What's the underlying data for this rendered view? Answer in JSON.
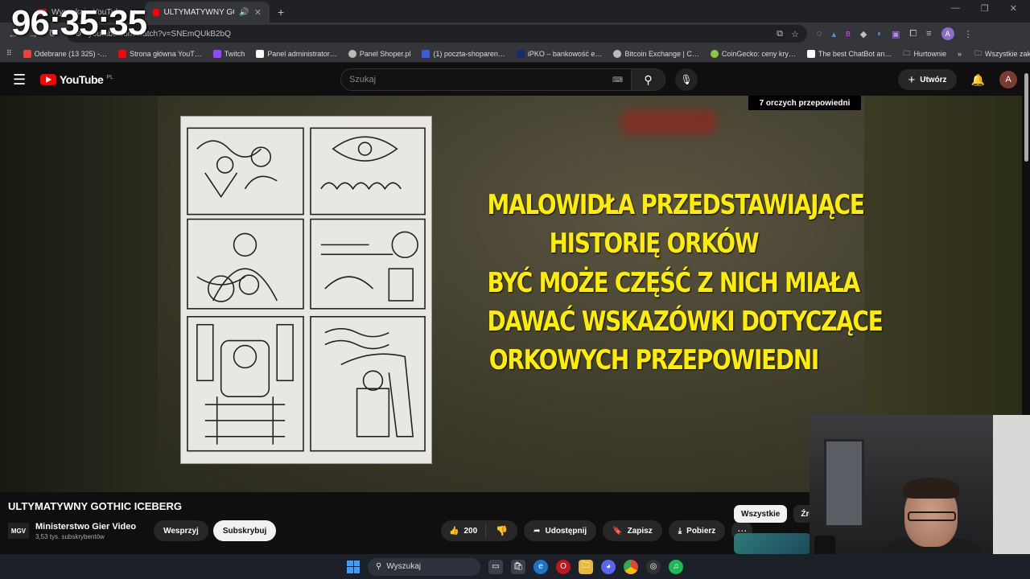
{
  "overlay": {
    "timer": "96:35:35"
  },
  "browser": {
    "tabs": [
      {
        "label": "Wyszukaj - YouTube",
        "active": false
      },
      {
        "label": "ULTYMATYWNY GOTHIC IC…",
        "active": true
      }
    ],
    "new_tab": "+",
    "url": "youtube.com/watch?v=SNEmQUkB2bQ",
    "bookmarks": [
      {
        "label": "Odebrane (13 325) -…",
        "color": "#ea4335"
      },
      {
        "label": "Strona główna YouT…",
        "color": "#ff0000"
      },
      {
        "label": "Twitch",
        "color": "#9146ff"
      },
      {
        "label": "Panel administrator…",
        "color": "#ffffff"
      },
      {
        "label": "Panel Shoper.pl",
        "color": "#bbbbbb"
      },
      {
        "label": "(1) poczta-shoparen…",
        "color": "#3b5bdb"
      },
      {
        "label": "iPKO – bankowość e…",
        "color": "#1b2a6b"
      },
      {
        "label": "Bitcoin Exchange | C…",
        "color": "#bbbbbb"
      },
      {
        "label": "CoinGecko: ceny kry…",
        "color": "#8dc63f"
      },
      {
        "label": "The best ChatBot an…",
        "color": "#ffffff"
      },
      {
        "label": "Hurtownie",
        "color": "#9aa0a6"
      }
    ],
    "all_bookmarks": "Wszystkie zakładki"
  },
  "youtube": {
    "logo_text": "YouTube",
    "region": "PL",
    "search_placeholder": "Szukaj",
    "create_label": "Utwórz",
    "avatar_letter": "A"
  },
  "video": {
    "corner_label": "7 orczych przepowiedni",
    "caption_lines": [
      "MALOWIDŁA PRZEDSTAWIAJĄCE",
      "HISTORIĘ ORKÓW",
      "BYĆ MOŻE CZĘŚĆ Z NICH MIAŁA",
      "DAWAĆ WSKAZÓWKI DOTYCZĄCE",
      "ORKOWYCH PRZEPOWIEDNI"
    ],
    "title": "ULTYMATYWNY GOTHIC ICEBERG",
    "channel": {
      "name": "Ministerstwo Gier Video",
      "subs": "3,53 tys. subskrybentów",
      "support_label": "Wesprzyj",
      "subscribe_label": "Subskrybuj"
    },
    "actions": {
      "likes": "200",
      "share": "Udostępnij",
      "save": "Zapisz",
      "download": "Pobierz"
    }
  },
  "recommendations": {
    "chips": [
      "Wszystkie",
      "Źródł"
    ]
  },
  "taskbar": {
    "search_placeholder": "Wyszukaj"
  },
  "colors": {
    "caption": "#ffee00",
    "accent": "#ff0000"
  }
}
